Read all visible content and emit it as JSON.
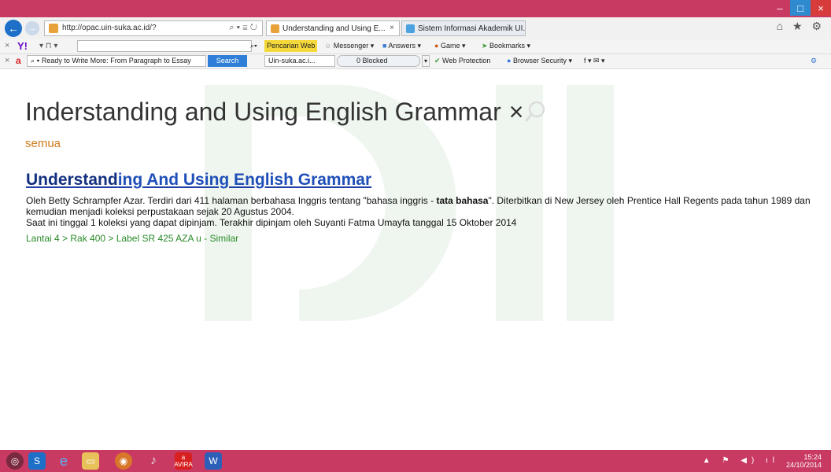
{
  "browser": {
    "address_url": "http://opac.uin-suka.ac.id/?",
    "address_controls": "⌕ ▾ ≣ ↻",
    "tabs": [
      {
        "label": "Understanding and Using E...",
        "close": "×"
      },
      {
        "label": "Sistem Informasi Akademik UI..."
      }
    ],
    "window_buttons": {
      "minimize": "–",
      "maximize": "□",
      "close": "×"
    },
    "top_icons": "⌂ ★ ⚙"
  },
  "toolbar1": {
    "close": "×",
    "yahoo_logo": "Y!",
    "small_controls": "▾ ⊓ ▾",
    "search_dropdown": "⌕▾",
    "pencarian": "Pencarian Web",
    "messenger": "Messenger ▾",
    "answers": "Answers ▾",
    "game": "Game ▾",
    "bookmarks": "Bookmarks ▾"
  },
  "toolbar2": {
    "close": "×",
    "avira_logo": "a",
    "search_value": "Ready to Write More: From Paragraph to Essay",
    "search_button": "Search",
    "site_field": "Uin-suka.ac.i...",
    "blocked": "0 Blocked",
    "web_protection": "Web Protection",
    "browser_security": "Browser Security ▾",
    "social": "f ▾ ✉ ▾"
  },
  "page": {
    "search_query": "Inderstanding and Using English Grammar",
    "clear": "×",
    "filter": "semua",
    "result": {
      "title_bold": "Understand",
      "title_rest": "ing And Using English Grammar",
      "desc_line1_pre": "Oleh Betty Schrampfer Azar. Terdiri dari 411 halaman berbahasa Inggris tentang \"bahasa inggris - ",
      "desc_line1_bold": "tata bahasa",
      "desc_line1_post": "\". Diterbitkan di New Jersey oleh Prentice Hall Regents pada tahun 1989 dan kemudian menjadi koleksi perpustakaan sejak 20 Agustus 2004.",
      "desc_line2": "Saat ini tinggal 1 koleksi yang dapat dipinjam. Terakhir dipinjam oleh Suyanti Fatma Umayfa tanggal 15 Oktober 2014",
      "location": "Lantai 4  >  Rak 400  >  Label SR 425 AZA u  -  Similar"
    }
  },
  "taskbar": {
    "time": "15:24",
    "date": "24/10/2014",
    "tray_icons": "▲ ⚑ ◀) ıl",
    "items": [
      "firefox-icon",
      "skype-icon",
      "ie-icon",
      "explorer-icon",
      "paint-icon",
      "media-icon",
      "avira-icon",
      "word-icon"
    ],
    "avira_label": "AVIRA"
  }
}
